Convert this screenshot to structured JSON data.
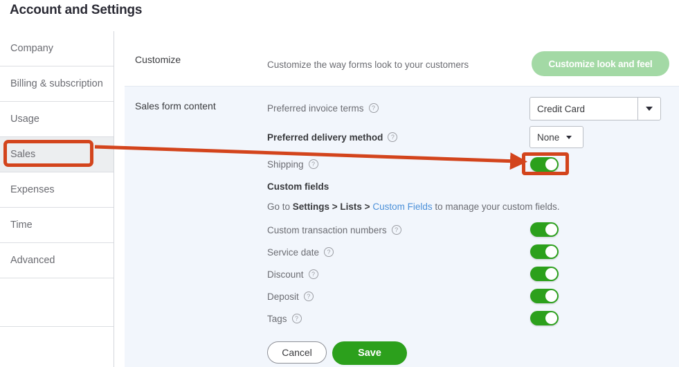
{
  "page": {
    "title": "Account and Settings"
  },
  "sidebar": {
    "items": [
      {
        "label": "Company",
        "selected": false
      },
      {
        "label": "Billing & subscription",
        "selected": false
      },
      {
        "label": "Usage",
        "selected": false
      },
      {
        "label": "Sales",
        "selected": true
      },
      {
        "label": "Expenses",
        "selected": false
      },
      {
        "label": "Time",
        "selected": false
      },
      {
        "label": "Advanced",
        "selected": false
      }
    ]
  },
  "customize": {
    "section_label": "Customize",
    "description": "Customize the way forms look to your customers",
    "button_label": "Customize look and feel"
  },
  "sales_form_content": {
    "section_label": "Sales form content",
    "preferred_invoice_terms": {
      "label": "Preferred invoice terms",
      "value": "Credit Card",
      "help": "?"
    },
    "preferred_delivery_method": {
      "label": "Preferred delivery method",
      "value": "None",
      "help": "?"
    },
    "shipping": {
      "label": "Shipping",
      "help": "?",
      "enabled": true
    },
    "custom_fields": {
      "heading": "Custom fields",
      "hint_prefix": "Go to ",
      "hint_bold": "Settings > Lists >",
      "hint_link": "Custom Fields",
      "hint_suffix": " to manage your custom fields."
    },
    "toggle_rows": [
      {
        "label": "Custom transaction numbers",
        "help": "?",
        "enabled": true
      },
      {
        "label": "Service date",
        "help": "?",
        "enabled": true
      },
      {
        "label": "Discount",
        "help": "?",
        "enabled": true
      },
      {
        "label": "Deposit",
        "help": "?",
        "enabled": true
      },
      {
        "label": "Tags",
        "help": "?",
        "enabled": true
      }
    ],
    "cancel_label": "Cancel",
    "save_label": "Save"
  },
  "annotations": {
    "highlight_color": "#d3441c",
    "sales_box": "Sales",
    "toggle_box": "Shipping toggle",
    "arrow": "arrow from Sales to Shipping toggle"
  },
  "colors": {
    "toggle_on": "#2ca01c",
    "save_button": "#2ca01c",
    "customize_button": "#a3d9a5",
    "link": "#4b90d9",
    "panel_bg": "#f2f6fc"
  }
}
